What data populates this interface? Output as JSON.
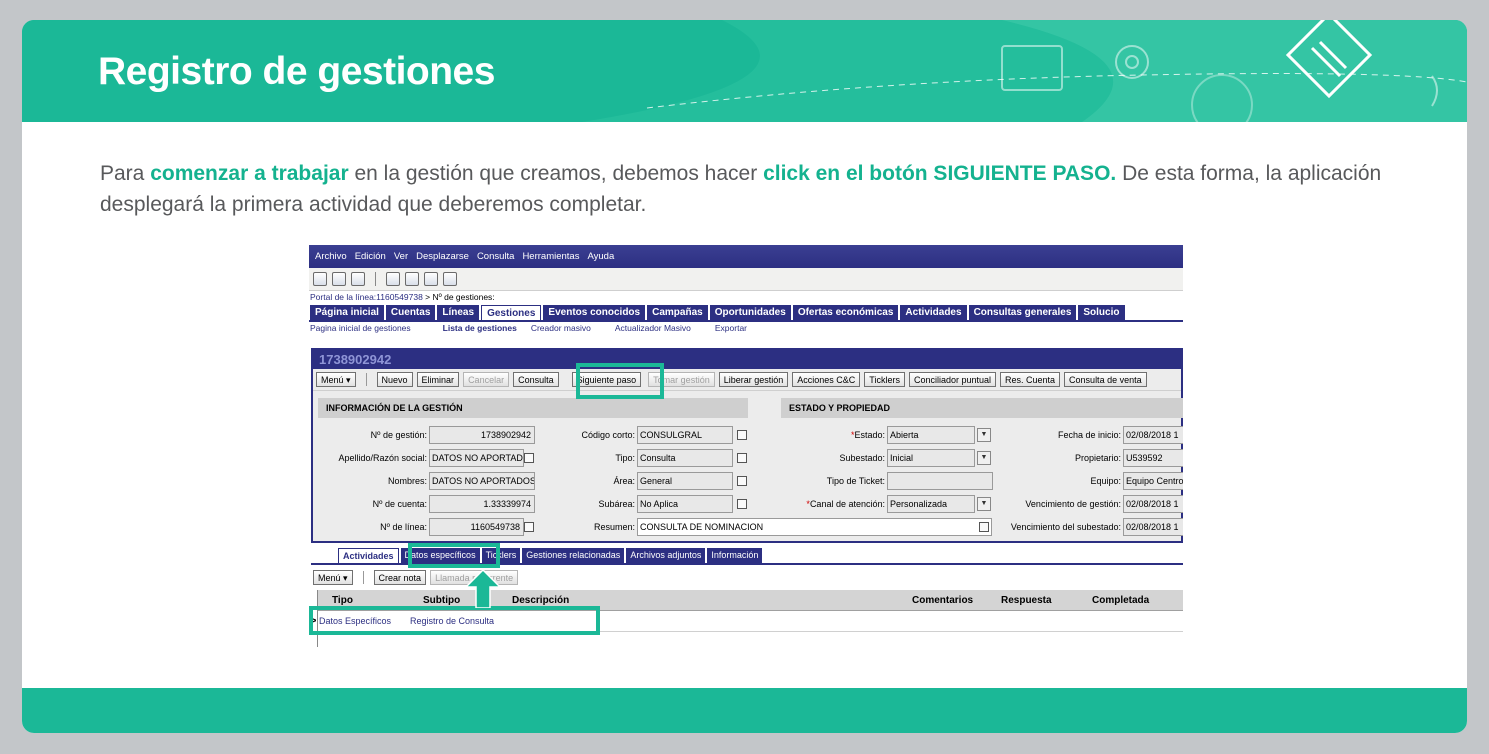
{
  "colors": {
    "accent": "#1bb897",
    "app_nav": "#2c2f82",
    "highlight_text": "#14b28f"
  },
  "header": {
    "title": "Registro de gestiones"
  },
  "intro": {
    "t1": "Para ",
    "t2": "comenzar a trabajar",
    "t3": " en la gestión que creamos, debemos hacer ",
    "t4": "click en el botón SIGUIENTE PASO.",
    "t5": " De esta forma, la aplicación desplegará la primera actividad que deberemos completar."
  },
  "app": {
    "menu": [
      "Archivo",
      "Edición",
      "Ver",
      "Desplazarse",
      "Consulta",
      "Herramientas",
      "Ayuda"
    ],
    "breadcrumb_link": "Portal de la línea:1160549738",
    "breadcrumb_rest": "  > Nº de gestiones:",
    "main_tabs": [
      "Página inicial",
      "Cuentas",
      "Líneas",
      "Gestiones",
      "Eventos conocidos",
      "Campañas",
      "Oportunidades",
      "Ofertas económicas",
      "Actividades",
      "Consultas generales",
      "Solucio"
    ],
    "sub_tabs": [
      "Pagina inicial de gestiones",
      "Lista de gestiones",
      "Creador masivo",
      "Actualizador Masivo",
      "Exportar"
    ],
    "record_id": "1738902942",
    "buttons": {
      "menu": "Menú ▾",
      "nuevo": "Nuevo",
      "eliminar": "Eliminar",
      "cancelar": "Cancelar",
      "consulta": "Consulta",
      "siguiente": "Siguiente paso",
      "tomar": "Tomar gestión",
      "liberar": "Liberar gestión",
      "acciones": "Acciones C&C",
      "ticklers": "Ticklers",
      "conciliador": "Conciliador puntual",
      "res_cuenta": "Res. Cuenta",
      "consulta_ventas": "Consulta de venta"
    },
    "sections": {
      "info": "INFORMACIÓN DE LA GESTIÓN",
      "estado": "ESTADO Y PROPIEDAD"
    },
    "fields": {
      "num_gestion_label": "Nº de gestión:",
      "num_gestion": "1738902942",
      "apellido_label": "Apellido/Razón social:",
      "apellido": "DATOS NO APORTAD",
      "nombres_label": "Nombres:",
      "nombres": "DATOS NO APORTADOS",
      "num_cuenta_label": "Nº de cuenta:",
      "num_cuenta": "1.33339974",
      "num_linea_label": "Nº de línea:",
      "num_linea": "1160549738",
      "codigo_label": "Código corto:",
      "codigo": "CONSULGRAL",
      "tipo_label": "Tipo:",
      "tipo": "Consulta",
      "area_label": "Área:",
      "area": "General",
      "subarea_label": "Subárea:",
      "subarea": "No Aplica",
      "resumen_label": "Resumen:",
      "resumen": "CONSULTA DE NOMINACION",
      "estado_label": "Estado:",
      "estado": "Abierta",
      "subestado_label": "Subestado:",
      "subestado": "Inicial",
      "tipo_ticket_label": "Tipo de Ticket:",
      "tipo_ticket": "",
      "canal_label": "Canal de atención:",
      "canal": "Personalizada",
      "fecha_inicio_label": "Fecha de inicio:",
      "fecha_inicio": "02/08/2018 1",
      "propietario_label": "Propietario:",
      "propietario": "U539592",
      "equipo_label": "Equipo:",
      "equipo": "Equipo Centro",
      "venc_gestion_label": "Vencimiento de gestión:",
      "venc_gestion": "02/08/2018 1",
      "venc_subestado_label": "Vencimiento del subestado:",
      "venc_subestado": "02/08/2018 1"
    },
    "lower_tabs": [
      "Actividades",
      "Datos específicos",
      "Ticklers",
      "Gestiones relacionadas",
      "Archivos adjuntos",
      "Información"
    ],
    "lower_buttons": {
      "menu": "Menú ▾",
      "crear_nota": "Crear nota",
      "llamada": "Llamada recurrente"
    },
    "grid": {
      "columns": [
        "Tipo",
        "Subtipo",
        "Descripción",
        "Comentarios",
        "Respuesta",
        "Completada"
      ],
      "rows": [
        {
          "tipo": "Datos Específicos",
          "subtipo": "Registro de Consulta",
          "descripcion": "",
          "comentarios": "",
          "respuesta": "",
          "completada": ""
        }
      ]
    }
  }
}
